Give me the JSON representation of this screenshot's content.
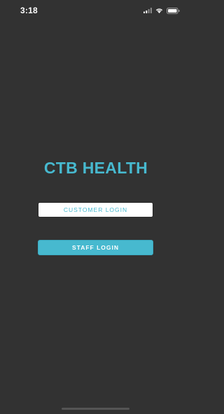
{
  "status_bar": {
    "time": "3:18",
    "icons": [
      "cellular-signal-icon",
      "wifi-icon",
      "battery-icon"
    ]
  },
  "brand": {
    "title": "CTB HEALTH",
    "accent_color": "#47b9cf"
  },
  "buttons": {
    "customer_login": "CUSTOMER LOGIN",
    "staff_login": "STAFF LOGIN"
  },
  "colors": {
    "background": "#323232",
    "accent": "#47b9cf",
    "customer_button_bg": "#ffffff"
  }
}
